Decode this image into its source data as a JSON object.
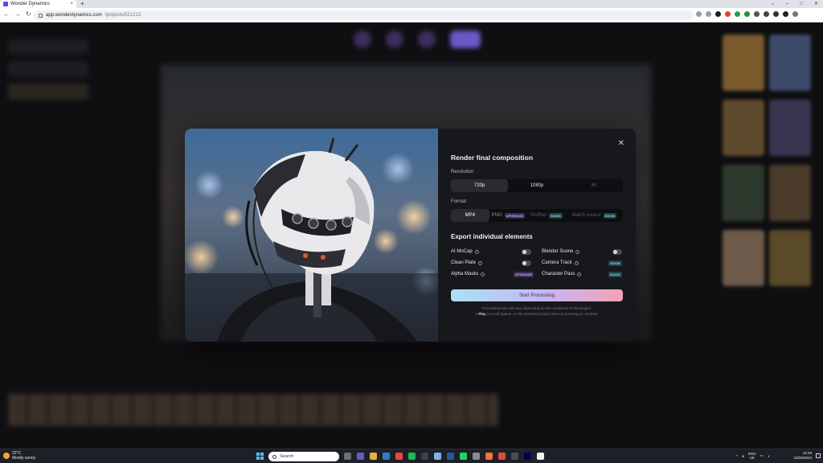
{
  "browser": {
    "tab_title": "Wonder Dynamics",
    "tab_close": "×",
    "new_tab": "+",
    "url_host": "app.wonderdynamics.com",
    "url_path": "/projects/521213",
    "window_controls": [
      "⌄",
      "–",
      "□",
      "✕"
    ],
    "nav": [
      "←",
      "→",
      "↻"
    ]
  },
  "modal": {
    "title": "Render final composition",
    "close": "✕",
    "resolution_label": "Resolution",
    "resolutions": [
      {
        "label": "720p",
        "state": "selected"
      },
      {
        "label": "1080p",
        "state": "normal"
      },
      {
        "label": "4K",
        "state": "disabled"
      }
    ],
    "format_label": "Format",
    "formats": [
      {
        "label": "MP4",
        "badge": "",
        "state": "selected"
      },
      {
        "label": "PNG",
        "badge": "UPGRADE",
        "state": "normal"
      },
      {
        "label": "ProRes",
        "badge": "SOON",
        "state": "disabled"
      },
      {
        "label": "Match source",
        "badge": "SOON",
        "state": "disabled"
      }
    ],
    "export_title": "Export individual elements",
    "elements_left": [
      {
        "label": "AI MoCap",
        "control": "toggle"
      },
      {
        "label": "Clean Plate",
        "control": "toggle"
      },
      {
        "label": "Alpha Masks",
        "control": "UPGRADE"
      }
    ],
    "elements_right": [
      {
        "label": "Blender Scene",
        "control": "toggle"
      },
      {
        "label": "Camera Track",
        "control": "SOON"
      },
      {
        "label": "Character Pass",
        "control": "SOON"
      }
    ],
    "info_glyph": "i",
    "cta": "Start Processing",
    "note_line1": "Processing time will vary depending on the complexity of the project.",
    "note_line2_a": "A",
    "note_line2_b": "Play",
    "note_line2_c": "icon will appear on the rendered project when processing is complete."
  },
  "taskbar": {
    "temp": "22°C",
    "weather": "Mostly sunny",
    "search": "Search",
    "lang1": "ENG",
    "lang2": "UK",
    "time": "15:49",
    "date": "23/08/2023"
  },
  "colors": {
    "accent_gradient": [
      "#a9e2f7",
      "#c7b5f2",
      "#f2a3b4"
    ],
    "upgrade_badge": "#3a2f52",
    "soon_badge": "#22434a"
  }
}
